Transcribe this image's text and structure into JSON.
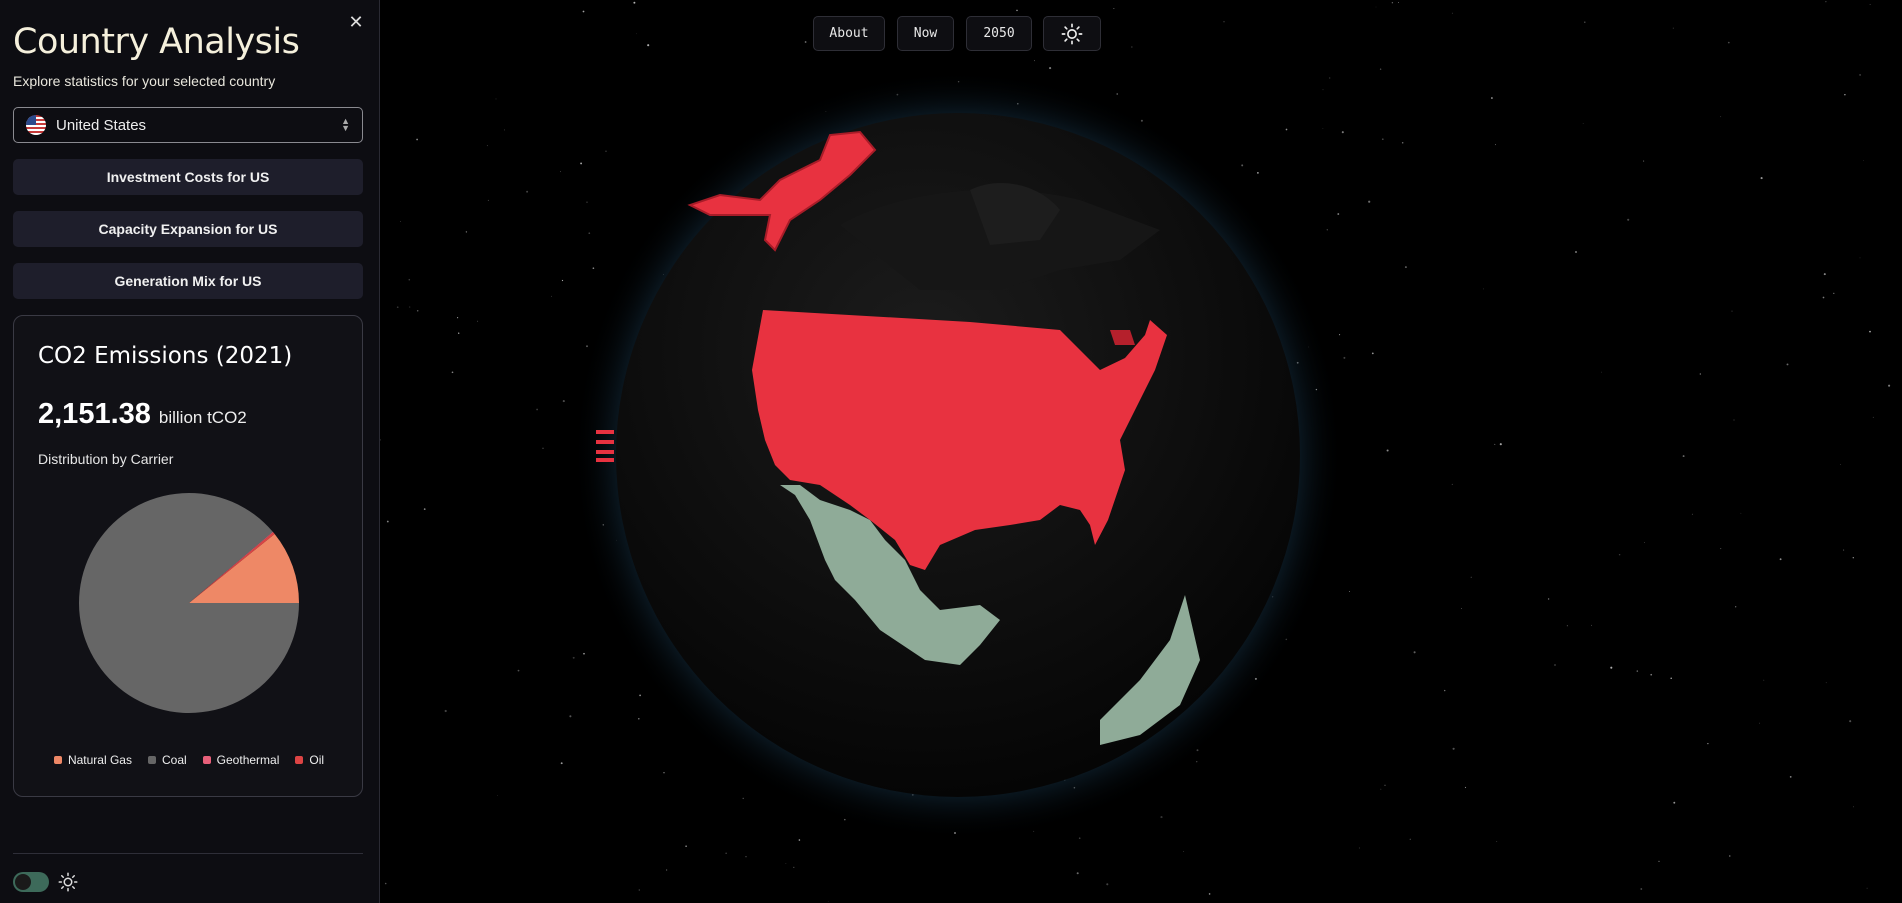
{
  "sidebar": {
    "title": "Country Analysis",
    "subtitle": "Explore statistics for your selected country",
    "close_icon": "close-icon",
    "country_select": {
      "value": "United States",
      "flag_icon": "us-flag-icon"
    },
    "buttons": [
      {
        "label": "Investment Costs for US"
      },
      {
        "label": "Capacity Expansion for US"
      },
      {
        "label": "Generation Mix for US"
      }
    ],
    "footer": {
      "toggle_icon": "toggle-switch",
      "theme_icon": "sun-icon"
    }
  },
  "emissions_card": {
    "title": "CO2 Emissions (2021)",
    "value": "2,151.38",
    "unit": "billion tCO2",
    "subtitle": "Distribution by Carrier"
  },
  "chart_data": {
    "type": "pie",
    "categories": [
      "Natural Gas",
      "Coal",
      "Geothermal",
      "Oil"
    ],
    "values": [
      10.8,
      88.8,
      0.1,
      0.3
    ],
    "colors": [
      "#ee8866",
      "#666666",
      "#e8607a",
      "#dd4444"
    ],
    "legend": "bottom"
  },
  "topbar": {
    "buttons": [
      {
        "label": "About"
      },
      {
        "label": "Now"
      },
      {
        "label": "2050"
      }
    ],
    "theme_icon": "sun-icon"
  },
  "globe": {
    "selected_country": "United States",
    "selected_color": "#e83240",
    "other_color": "#8fab98",
    "background": "#000000"
  }
}
